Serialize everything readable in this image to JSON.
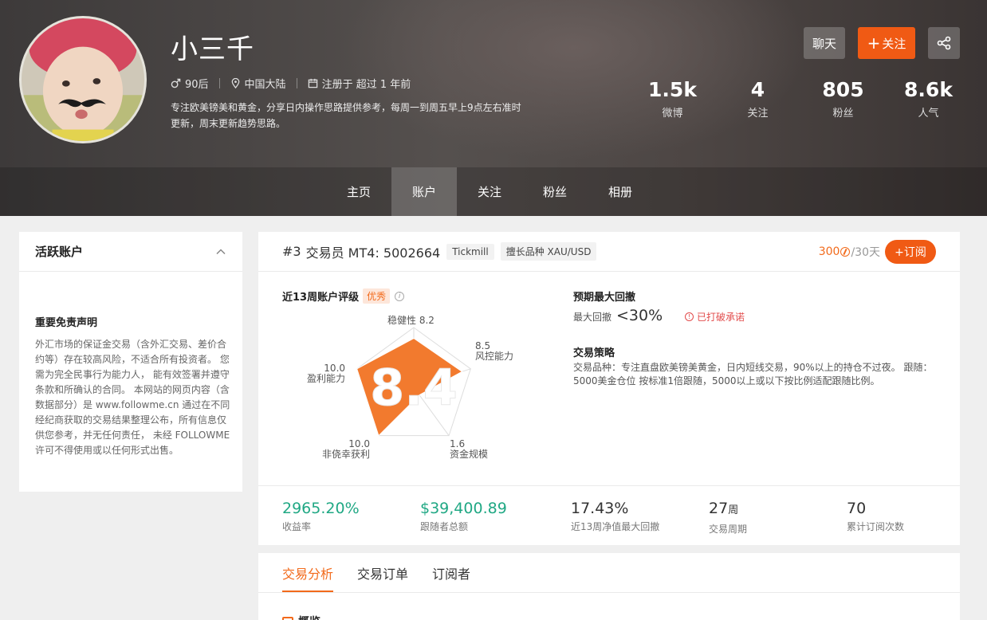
{
  "profile": {
    "name": "小三千",
    "age_group": "90后",
    "location": "中国大陆",
    "registered": "注册于 超过 1 年前",
    "bio": "专注欧美镑美和黄金，分享日内操作思路提供参考，每周一到周五早上9点左右准时更新，周末更新趋势思路。"
  },
  "actions": {
    "chat": "聊天",
    "follow": "关注",
    "follow_plus": "+"
  },
  "stats": [
    {
      "value": "1.5k",
      "label": "微博"
    },
    {
      "value": "4",
      "label": "关注"
    },
    {
      "value": "805",
      "label": "粉丝"
    },
    {
      "value": "8.6k",
      "label": "人气"
    }
  ],
  "nav": [
    "主页",
    "账户",
    "关注",
    "粉丝",
    "相册"
  ],
  "sidebar": {
    "title": "活跃账户",
    "disclaimer_title": "重要免责声明",
    "disclaimer_text": "外汇市场的保证金交易（含外汇交易、差价合约等）存在较高风险，不适合所有投资者。 您需为完全民事行为能力人， 能有效签署并遵守条款和所确认的合同。 本网站的网页内容（含数据部分）是 www.followme.cn 通过在不同经纪商获取的交易结果整理公布，所有信息仅供您参考，并无任何责任， 未经 FOLLOWME 许可不得使用或以任何形式出售。"
  },
  "account": {
    "rank": "#3",
    "title": "交易员 MT4: 5002664",
    "broker": "Tickmill",
    "specialty": "擅长品种 XAU/USD",
    "price": "300",
    "period": "/30天",
    "subscribe": "+订阅"
  },
  "rating": {
    "title": "近13周账户评级",
    "badge": "优秀",
    "score": "8.4",
    "axes": [
      {
        "name": "稳健性",
        "value": "8.2"
      },
      {
        "name": "风控能力",
        "value": "8.5"
      },
      {
        "name": "资金规模",
        "value": "1.6"
      },
      {
        "name": "非侥幸获利",
        "value": "10.0"
      },
      {
        "name": "盈利能力",
        "value": "10.0"
      }
    ],
    "colors": {
      "fill": "#f27a2e",
      "grid": "#dddddd"
    }
  },
  "drawdown": {
    "title": "预期最大回撤",
    "label": "最大回撤",
    "value": "<30%",
    "warning": "已打破承诺"
  },
  "strategy": {
    "title": "交易策略",
    "text": "交易品种：专注直盘欧美镑美黄金，日内短线交易，90%以上的持仓不过夜。 跟随：5000美金仓位 按标准1倍跟随，5000以上或以下按比例适配跟随比例。"
  },
  "metrics": [
    {
      "value": "2965.20%",
      "label": "收益率",
      "green": true
    },
    {
      "value": "$39,400.89",
      "label": "跟随者总额",
      "green": true
    },
    {
      "value": "17.43%",
      "label": "近13周净值最大回撤",
      "green": false
    },
    {
      "value": "27",
      "unit": "周",
      "label": "交易周期",
      "green": false
    },
    {
      "value": "70",
      "label": "累计订阅次数",
      "green": false
    }
  ],
  "tabs": [
    "交易分析",
    "交易订单",
    "订阅者"
  ],
  "section_peek": "概览"
}
